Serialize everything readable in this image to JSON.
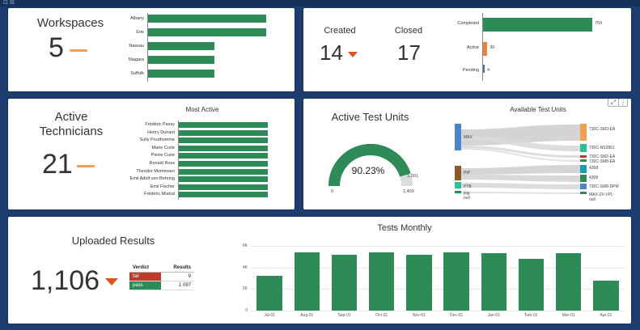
{
  "workspaces": {
    "label": "Workspaces",
    "count": "5",
    "items": [
      {
        "name": "Albany",
        "value": 1.0
      },
      {
        "name": "Erie",
        "value": 1.0
      },
      {
        "name": "Nassau",
        "value": 0.56
      },
      {
        "name": "Niagara",
        "value": 0.56
      },
      {
        "name": "Suffolk",
        "value": 0.56
      }
    ]
  },
  "tests": {
    "created_label": "Created",
    "created_value": "14",
    "closed_label": "Closed",
    "closed_value": "17",
    "status": [
      {
        "name": "Completed",
        "value": 759
      },
      {
        "name": "Active",
        "value": 30
      },
      {
        "name": "Pending",
        "value": 4
      }
    ],
    "status_value_labels": [
      "759",
      "30",
      "4"
    ],
    "status_colors": [
      "#2e8b57",
      "#e8853a",
      "#4a6fa5"
    ]
  },
  "technicians": {
    "label_line1": "Active",
    "label_line2": "Technicians",
    "count": "21",
    "chart_title": "Most Active",
    "names": [
      "Frédéric Passy",
      "Henry Dunant",
      "Sully Prudhomme",
      "Marie Curie",
      "Pierre Curie",
      "Ronald Ross",
      "Theodor Mommsen",
      "Emil Adolf von Behring",
      "Emil Fischer",
      "Frédéric Mistral"
    ],
    "values": [
      1.0,
      1.0,
      1.0,
      1.0,
      1.0,
      1.0,
      1.0,
      1.0,
      1.0,
      1.0
    ]
  },
  "units": {
    "label": "Active Test Units",
    "gauge_value": "90.23%",
    "gauge_fraction": 0.9023,
    "gauge_min": "0",
    "gauge_mid": "1,001",
    "gauge_max": "1,400",
    "sankey_title": "Available Test Units",
    "sources": [
      "MAX",
      "PIP",
      "PTB",
      "PM",
      "null"
    ],
    "targets": [
      "730C-SM3-EA",
      "730C-NS2861",
      "730C-SM2-EA",
      "730C-SM8-EA",
      "4358",
      "4308",
      "730C-SM8-DPM",
      "MAX-2X-VPL",
      "null"
    ],
    "expand_icon": "expand-icon",
    "more_icon": "more-vertical-icon"
  },
  "uploaded": {
    "label": "Uploaded Results",
    "count": "1,106",
    "table_headers": [
      "Verdict",
      "Results"
    ],
    "rows": [
      {
        "verdict": "fail",
        "results": "9"
      },
      {
        "verdict": "pass",
        "results": "1 097"
      }
    ]
  },
  "chart_data": {
    "type": "bar",
    "title": "Tests Monthly",
    "categories": [
      "Jul-01",
      "Aug-01",
      "Sep-01",
      "Oct-01",
      "Nov-01",
      "Dec-01",
      "Jan-01",
      "Feb-01",
      "Mar-01",
      "Apr-01"
    ],
    "values": [
      3200,
      5400,
      5200,
      5400,
      5200,
      5400,
      5300,
      4800,
      5300,
      2800
    ],
    "yticks": [
      "0",
      "2K",
      "4K",
      "6K"
    ],
    "ylim": [
      0,
      6000
    ],
    "bar_color": "#2e8b57"
  },
  "colors": {
    "background": "#1c3d6e",
    "bar_green": "#2e8b57",
    "accent_orange": "#f0a050",
    "down_arrow": "#d9541e"
  }
}
